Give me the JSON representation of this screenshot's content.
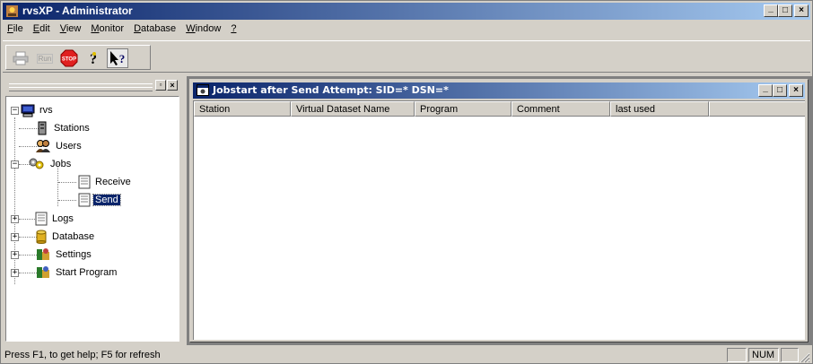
{
  "app": {
    "title": "rvsXP - Administrator",
    "icon": "rvs-app-icon"
  },
  "caption_buttons": {
    "minimize": "_",
    "maximize": "□",
    "close": "×"
  },
  "menu": [
    {
      "label": "File",
      "accel": "F"
    },
    {
      "label": "Edit",
      "accel": "E"
    },
    {
      "label": "View",
      "accel": "V"
    },
    {
      "label": "Monitor",
      "accel": "M"
    },
    {
      "label": "Database",
      "accel": "D"
    },
    {
      "label": "Window",
      "accel": "W"
    },
    {
      "label": "?",
      "accel": "?"
    }
  ],
  "toolbar": {
    "print_icon": "printer-icon",
    "run_label": "Run",
    "stop_label": "STOP",
    "help_icon": "help-question-icon",
    "context_help_icon": "context-help-icon"
  },
  "tree": {
    "root": "rvs",
    "items": [
      {
        "label": "Stations",
        "icon": "stations-icon"
      },
      {
        "label": "Users",
        "icon": "users-icon"
      },
      {
        "label": "Jobs",
        "icon": "jobs-icon"
      },
      {
        "label": "Receive",
        "icon": "document-icon"
      },
      {
        "label": "Send",
        "icon": "document-icon",
        "selected": true
      },
      {
        "label": "Logs",
        "icon": "document-icon"
      },
      {
        "label": "Database",
        "icon": "database-icon"
      },
      {
        "label": "Settings",
        "icon": "settings-icon"
      },
      {
        "label": "Start Program",
        "icon": "start-program-icon"
      }
    ]
  },
  "child_window": {
    "title": "Jobstart after Send Attempt: SID=*  DSN=*",
    "columns": [
      "Station",
      "Virtual Dataset Name",
      "Program",
      "Comment",
      "last used"
    ]
  },
  "status": {
    "text": "Press F1, to get help; F5 for refresh",
    "num": "NUM"
  },
  "colors": {
    "title_active_start": "#0a246a",
    "title_active_end": "#a6caf0",
    "face": "#d4d0c8",
    "selection": "#0a246a"
  }
}
